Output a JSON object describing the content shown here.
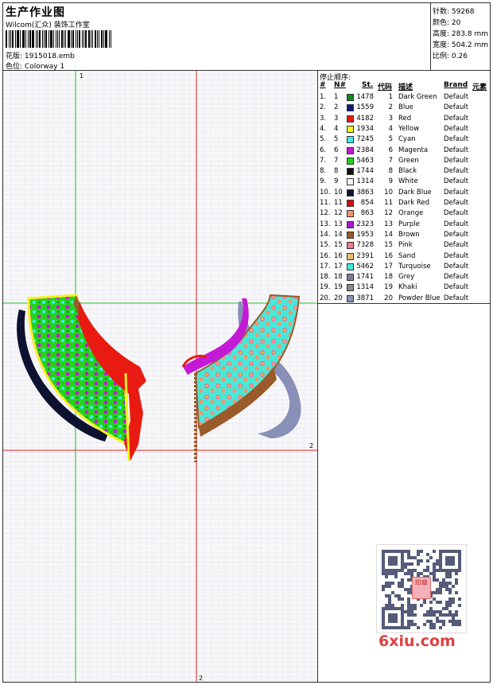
{
  "header": {
    "title": "生产作业图",
    "company": "Wilcom(汇众) 装饰工作室",
    "file_label": "花版:",
    "file_name": "1915018.emb",
    "colorway_label": "色位:",
    "colorway": "Colorway 1"
  },
  "stats": {
    "stitches": "针数: 59268",
    "colors": "颜色: 20",
    "height": "高度: 283.8 mm",
    "width": "宽度: 504.2 mm",
    "scale": "比例: 0.26"
  },
  "canvas": {
    "marker_top": "1",
    "marker_right": "2",
    "marker_bottom": "2"
  },
  "thread_list": {
    "title": "停止顺序:",
    "columns": [
      "#",
      "N#",
      "St.",
      "代码",
      "描述",
      "Brand",
      "元素"
    ],
    "rows": [
      {
        "idx": "1.",
        "n": "1",
        "st": "1478",
        "code": "1",
        "desc": "Dark Green",
        "brand": "Default",
        "color": "#0b8a1e"
      },
      {
        "idx": "2.",
        "n": "2",
        "st": "1559",
        "code": "2",
        "desc": "Blue",
        "brand": "Default",
        "color": "#0a1a7a"
      },
      {
        "idx": "3.",
        "n": "3",
        "st": "4182",
        "code": "3",
        "desc": "Red",
        "brand": "Default",
        "color": "#e81a12"
      },
      {
        "idx": "4.",
        "n": "4",
        "st": "1934",
        "code": "4",
        "desc": "Yellow",
        "brand": "Default",
        "color": "#f8f020"
      },
      {
        "idx": "5.",
        "n": "5",
        "st": "7245",
        "code": "5",
        "desc": "Cyan",
        "brand": "Default",
        "color": "#40e8f0"
      },
      {
        "idx": "6.",
        "n": "6",
        "st": "2384",
        "code": "6",
        "desc": "Magenta",
        "brand": "Default",
        "color": "#c41ad8"
      },
      {
        "idx": "7.",
        "n": "7",
        "st": "5463",
        "code": "7",
        "desc": "Green",
        "brand": "Default",
        "color": "#24d41a"
      },
      {
        "idx": "8.",
        "n": "8",
        "st": "1744",
        "code": "8",
        "desc": "Black",
        "brand": "Default",
        "color": "#101010"
      },
      {
        "idx": "9.",
        "n": "9",
        "st": "1314",
        "code": "9",
        "desc": "White",
        "brand": "Default",
        "color": "#f4f4f4"
      },
      {
        "idx": "10.",
        "n": "10",
        "st": "3863",
        "code": "10",
        "desc": "Dark Blue",
        "brand": "Default",
        "color": "#0e1230"
      },
      {
        "idx": "11.",
        "n": "11",
        "st": "854",
        "code": "11",
        "desc": "Dark Red",
        "brand": "Default",
        "color": "#d40a0a"
      },
      {
        "idx": "12.",
        "n": "12",
        "st": "863",
        "code": "12",
        "desc": "Orange",
        "brand": "Default",
        "color": "#f49470"
      },
      {
        "idx": "13.",
        "n": "13",
        "st": "2323",
        "code": "13",
        "desc": "Purple",
        "brand": "Default",
        "color": "#a81ad0"
      },
      {
        "idx": "14.",
        "n": "14",
        "st": "1953",
        "code": "14",
        "desc": "Brown",
        "brand": "Default",
        "color": "#9a5a2a"
      },
      {
        "idx": "15.",
        "n": "15",
        "st": "7328",
        "code": "15",
        "desc": "Pink",
        "brand": "Default",
        "color": "#f07890"
      },
      {
        "idx": "16.",
        "n": "16",
        "st": "2391",
        "code": "16",
        "desc": "Sand",
        "brand": "Default",
        "color": "#e8c070"
      },
      {
        "idx": "17.",
        "n": "17",
        "st": "5462",
        "code": "17",
        "desc": "Turquoise",
        "brand": "Default",
        "color": "#48e8d8"
      },
      {
        "idx": "18.",
        "n": "18",
        "st": "1741",
        "code": "18",
        "desc": "Grey",
        "brand": "Default",
        "color": "#7a7e9a"
      },
      {
        "idx": "19.",
        "n": "19",
        "st": "1314",
        "code": "19",
        "desc": "Khaki",
        "brand": "Default",
        "color": "#8a8a86"
      },
      {
        "idx": "20.",
        "n": "20",
        "st": "3871",
        "code": "20",
        "desc": "Powder Blue",
        "brand": "Default",
        "color": "#8890b8"
      }
    ]
  },
  "watermark": {
    "site": "6xiu.com",
    "seal_text": "印章"
  }
}
